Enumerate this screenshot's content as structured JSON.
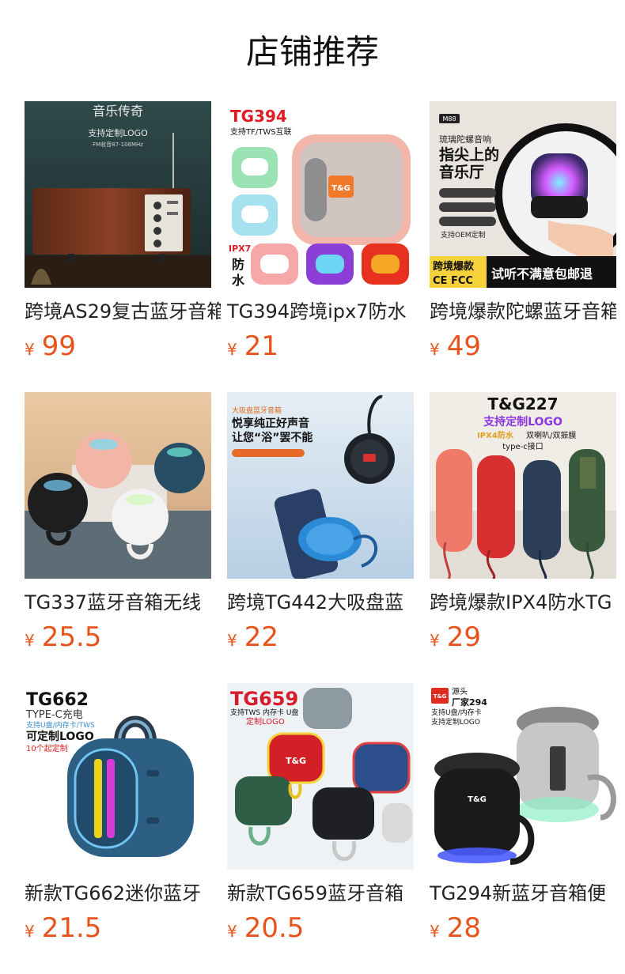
{
  "header": {
    "title": "店铺推荐"
  },
  "currency_symbol": "¥",
  "products": [
    {
      "name": "跨境AS29复古蓝牙音箱",
      "price": "99",
      "image_text": {
        "t1": "音乐传奇",
        "t2": "支持定制LOGO",
        "t3": "FM收音87-108MHz"
      }
    },
    {
      "name": "TG394跨境ipx7防水",
      "price": "21",
      "image_text": {
        "t1": "TG394",
        "t2": "支持TF/TWS互联",
        "t3": "IPX7",
        "t4": "防",
        "t5": "水",
        "t6": "T&G"
      }
    },
    {
      "name": "跨境爆款陀螺蓝牙音箱",
      "price": "49",
      "image_text": {
        "t1": "M88",
        "t2": "琉璃陀螺音响",
        "t3": "指尖上的",
        "t4": "音乐厅",
        "t5": "支持OEM定制",
        "t6": "跨境爆款",
        "t7": "CE FCC",
        "t8": "试听不满意包邮退"
      }
    },
    {
      "name": "TG337蓝牙音箱无线",
      "price": "25.5",
      "image_text": {}
    },
    {
      "name": "跨境TG442大吸盘蓝",
      "price": "22",
      "image_text": {
        "t1": "大吸盘蓝牙音箱",
        "t2": "悦享纯正好声音",
        "t3": "让您“浴”罢不能"
      }
    },
    {
      "name": "跨境爆款IPX4防水TG",
      "price": "29",
      "image_text": {
        "t1": "T&G227",
        "t2": "支持定制LOGO",
        "t3": "IPX4防水",
        "t4": "双喇叭/双振膜",
        "t5": "type-c接口"
      }
    },
    {
      "name": "新款TG662迷你蓝牙",
      "price": "21.5",
      "image_text": {
        "t1": "TG662",
        "t2": "TYPE-C充电",
        "t3": "支持U盘/内存卡/TWS",
        "t4": "可定制LOGO",
        "t5": "10个起定制"
      }
    },
    {
      "name": "新款TG659蓝牙音箱",
      "price": "20.5",
      "image_text": {
        "t1": "TG659",
        "t2": "支持TWS 内存卡 U盘",
        "t3": "定制LOGO",
        "t4": "T&G"
      }
    },
    {
      "name": "TG294新蓝牙音箱便",
      "price": "28",
      "image_text": {
        "t1": "T&G",
        "t2": "源头",
        "t3": "厂家294",
        "t4": "支持U盘/内存卡",
        "t5": "支持定制LOGO"
      }
    }
  ]
}
